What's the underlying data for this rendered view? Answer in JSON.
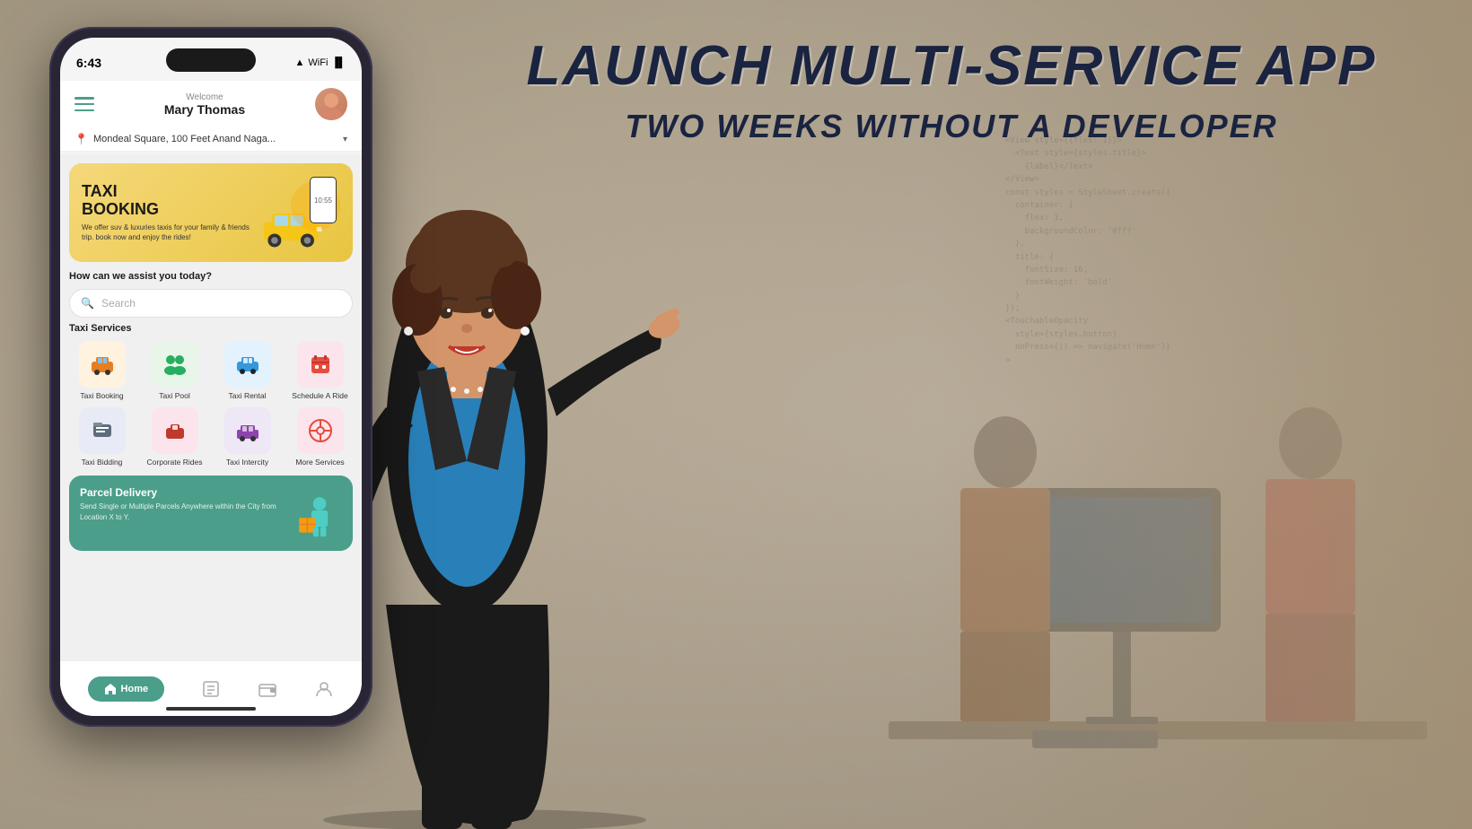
{
  "background": {
    "color1": "#c8b89a",
    "color2": "#bfb09a"
  },
  "headline": {
    "title": "LAUNCH MULTI-SERVICE APP",
    "subtitle": "TWO WEEKS WITHOUT A DEVELOPER"
  },
  "phone": {
    "status_bar": {
      "time": "6:43",
      "signal_icon": "▲",
      "wifi_icon": "wifi",
      "battery_icon": "battery"
    },
    "header": {
      "welcome_label": "Welcome",
      "user_name": "Mary Thomas"
    },
    "location": {
      "pin_icon": "📍",
      "address": "Mondeal Square, 100 Feet Anand Naga...",
      "chevron": "▾"
    },
    "banner": {
      "title_line1": "TAXI",
      "title_line2": "BOOKING",
      "description": "We offer suv & luxuries taxis for your family & friends trip. book now and enjoy the rides!"
    },
    "assist_section": {
      "title": "How can we assist you today?",
      "search_placeholder": "Search"
    },
    "taxi_services": {
      "section_title": "Taxi Services",
      "items": [
        {
          "label": "Taxi Booking",
          "icon": "🚕",
          "color_class": "icon-taxi"
        },
        {
          "label": "Taxi Pool",
          "icon": "👥",
          "color_class": "icon-pool"
        },
        {
          "label": "Taxi Rental",
          "icon": "🚗",
          "color_class": "icon-rental"
        },
        {
          "label": "Schedule A Ride",
          "icon": "📅",
          "color_class": "icon-schedule"
        },
        {
          "label": "Taxi Bidding",
          "icon": "🏷️",
          "color_class": "icon-bid"
        },
        {
          "label": "Corporate Rides",
          "icon": "💼",
          "color_class": "icon-corp"
        },
        {
          "label": "Taxi Intercity",
          "icon": "🏙️",
          "color_class": "icon-intercity"
        },
        {
          "label": "More Services",
          "icon": "⊕",
          "color_class": "icon-more"
        }
      ]
    },
    "parcel_section": {
      "title": "Parcel Delivery",
      "description": "Send Single or Multiple Parcels Anywhere within the City from Location X to Y."
    },
    "bottom_nav": {
      "home_label": "Home",
      "bookings_icon": "☰",
      "wallet_icon": "◫",
      "profile_icon": "👤"
    }
  }
}
